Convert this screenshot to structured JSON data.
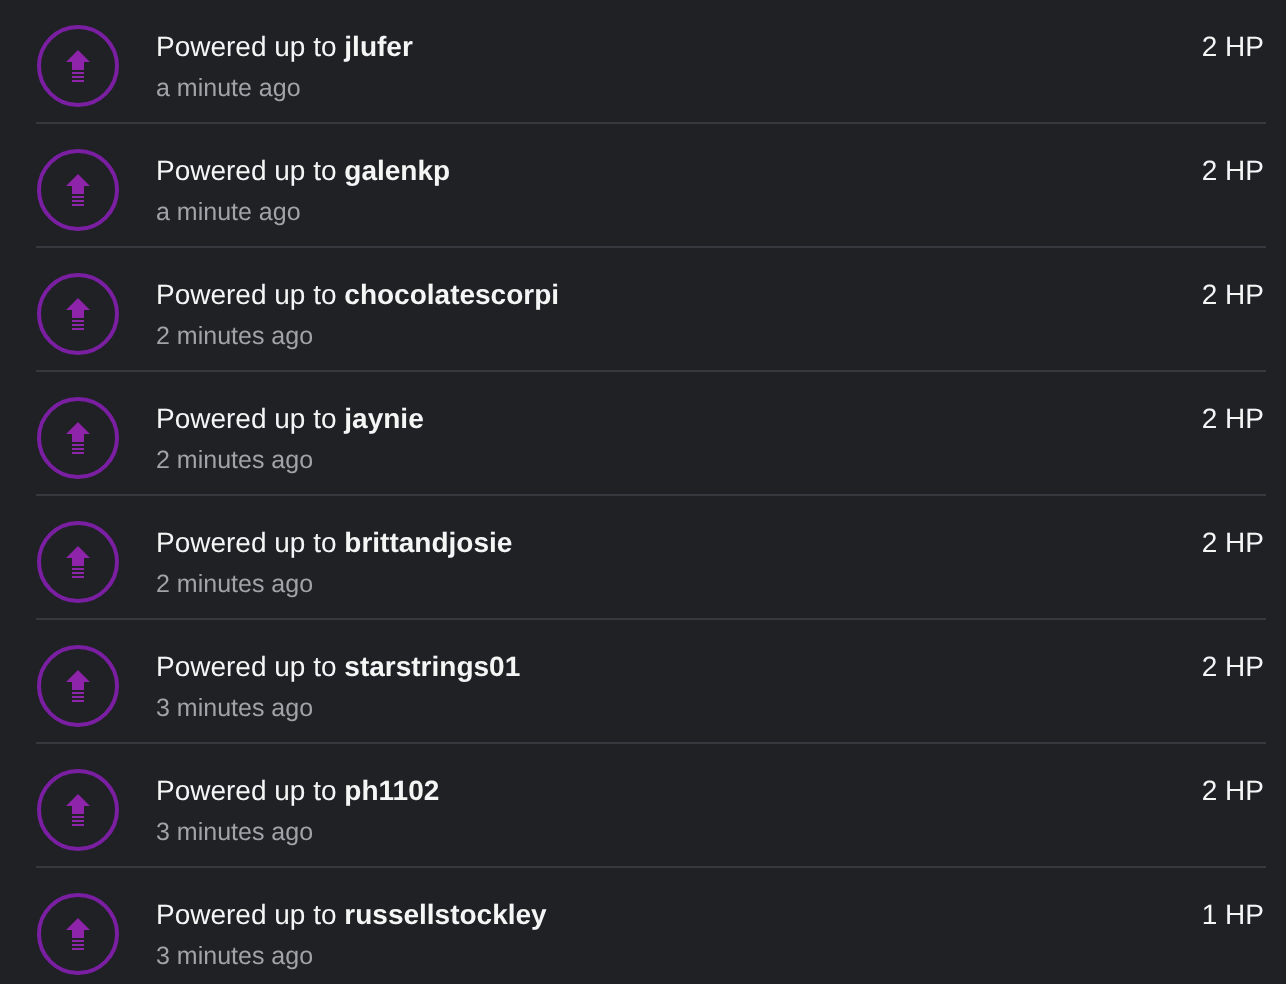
{
  "activity": [
    {
      "message": "Powered up to **jlufer**",
      "time": "a minute ago",
      "amount": "2 HP"
    },
    {
      "message": "Powered up to **galenkp**",
      "time": "a minute ago",
      "amount": "2 HP"
    },
    {
      "message": "Powered up to **chocolatescorpi**",
      "time": "2 minutes ago",
      "amount": "2 HP"
    },
    {
      "message": "Powered up to **jaynie**",
      "time": "2 minutes ago",
      "amount": "2 HP"
    },
    {
      "message": "Powered up to **brittandjosie**",
      "time": "2 minutes ago",
      "amount": "2 HP"
    },
    {
      "message": "Powered up to **starstrings01**",
      "time": "3 minutes ago",
      "amount": "2 HP"
    },
    {
      "message": "Powered up to **ph1102**",
      "time": "3 minutes ago",
      "amount": "2 HP"
    },
    {
      "message": "Powered up to **russellstockley**",
      "time": "3 minutes ago",
      "amount": "1 HP"
    }
  ]
}
